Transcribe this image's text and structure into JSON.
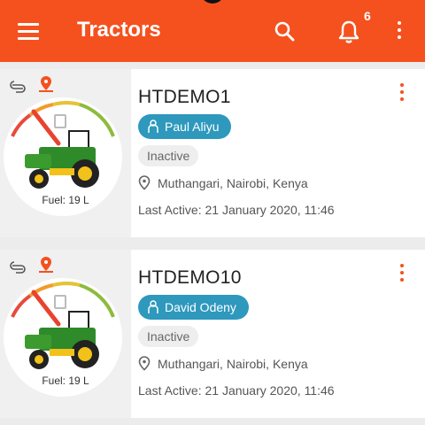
{
  "appbar": {
    "title": "Tractors",
    "notification_count": "6",
    "icons": [
      "menu-icon",
      "search-icon",
      "bell-icon",
      "more-vertical-icon"
    ],
    "background": "#f4511e"
  },
  "tractors": [
    {
      "name": "HTDEMO1",
      "driver": "Paul Aliyu",
      "status": "Inactive",
      "location": "Muthangari, Nairobi, Kenya",
      "last_active": "Last Active: 21 January 2020, 11:46",
      "fuel": "Fuel: 19 L"
    },
    {
      "name": "HTDEMO10",
      "driver": "David Odeny",
      "status": "Inactive",
      "location": "Muthangari, Nairobi, Kenya",
      "last_active": "Last Active: 21 January 2020, 11:46",
      "fuel": "Fuel: 19 L"
    }
  ],
  "colors": {
    "accent": "#f4511e",
    "driver_chip": "#2e98bd",
    "status_chip": "#eeeeee"
  }
}
